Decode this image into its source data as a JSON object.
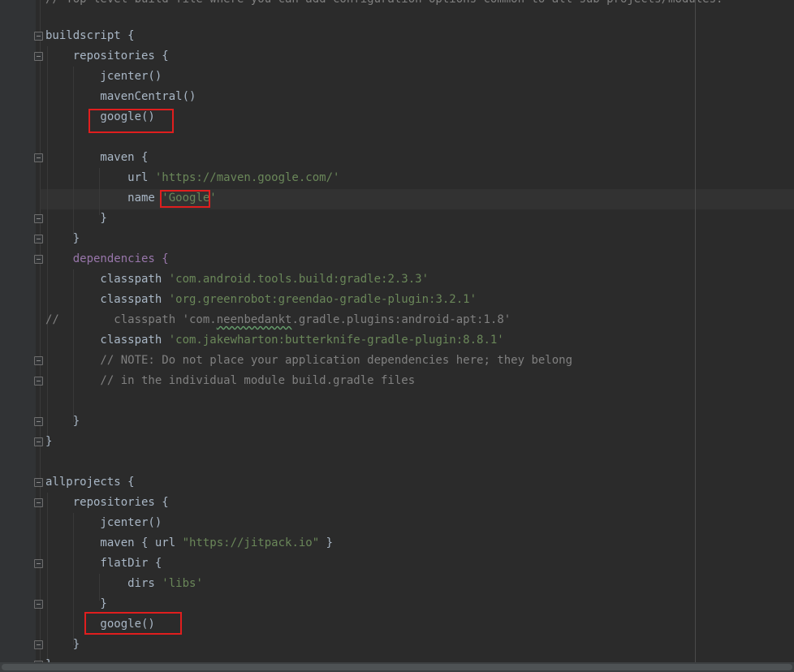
{
  "editor": {
    "top_fragment": "// Top-level build file where you can add configuration options common to all sub-projects/modules.",
    "lines": [
      {
        "parts": [
          {
            "t": "buildscript {",
            "c": "kw"
          }
        ]
      },
      {
        "parts": [
          {
            "t": "    repositories {",
            "c": "kw"
          }
        ]
      },
      {
        "parts": [
          {
            "t": "        jcenter()",
            "c": "fn"
          }
        ]
      },
      {
        "parts": [
          {
            "t": "        mavenCentral()",
            "c": "fn"
          }
        ]
      },
      {
        "parts": [
          {
            "t": "        google()",
            "c": "fn"
          }
        ]
      },
      {
        "parts": [
          {
            "t": "",
            "c": "kw"
          }
        ]
      },
      {
        "parts": [
          {
            "t": "        maven {",
            "c": "kw"
          }
        ]
      },
      {
        "parts": [
          {
            "t": "            url ",
            "c": "kw"
          },
          {
            "t": "'https://maven.google.com/'",
            "c": "str"
          }
        ]
      },
      {
        "parts": [
          {
            "t": "            name ",
            "c": "kw"
          },
          {
            "t": "'Google'",
            "c": "str"
          }
        ]
      },
      {
        "parts": [
          {
            "t": "        }",
            "c": "kw"
          }
        ]
      },
      {
        "parts": [
          {
            "t": "    }",
            "c": "kw"
          }
        ]
      },
      {
        "parts": [
          {
            "t": "    dependencies {",
            "c": "kw2"
          }
        ]
      },
      {
        "parts": [
          {
            "t": "        classpath ",
            "c": "kw"
          },
          {
            "t": "'com.android.tools.build:gradle:2.3.3'",
            "c": "str"
          }
        ]
      },
      {
        "parts": [
          {
            "t": "        classpath ",
            "c": "kw"
          },
          {
            "t": "'org.greenrobot:greendao-gradle-plugin:3.2.1'",
            "c": "str"
          }
        ]
      },
      {
        "parts": [
          {
            "t": "//        classpath ",
            "c": "cm"
          },
          {
            "t": "'com.neenbedankt.gradle.plugins:android-apt:1.8'",
            "c": "cm"
          }
        ]
      },
      {
        "parts": [
          {
            "t": "        classpath ",
            "c": "kw"
          },
          {
            "t": "'com.jakewharton:butterknife-gradle-plugin:8.8.1'",
            "c": "str"
          }
        ]
      },
      {
        "parts": [
          {
            "t": "        // NOTE: Do not place your application dependencies here; they belong",
            "c": "cm"
          }
        ]
      },
      {
        "parts": [
          {
            "t": "        // in the individual module build.gradle files",
            "c": "cm"
          }
        ]
      },
      {
        "parts": [
          {
            "t": "",
            "c": "kw"
          }
        ]
      },
      {
        "parts": [
          {
            "t": "    }",
            "c": "kw"
          }
        ]
      },
      {
        "parts": [
          {
            "t": "}",
            "c": "kw"
          }
        ]
      },
      {
        "parts": [
          {
            "t": "",
            "c": "kw"
          }
        ]
      },
      {
        "parts": [
          {
            "t": "allprojects {",
            "c": "kw"
          }
        ]
      },
      {
        "parts": [
          {
            "t": "    repositories {",
            "c": "kw"
          }
        ]
      },
      {
        "parts": [
          {
            "t": "        jcenter()",
            "c": "fn"
          }
        ]
      },
      {
        "parts": [
          {
            "t": "        maven { url ",
            "c": "kw"
          },
          {
            "t": "\"https://jitpack.io\"",
            "c": "str"
          },
          {
            "t": " }",
            "c": "kw"
          }
        ]
      },
      {
        "parts": [
          {
            "t": "        flatDir {",
            "c": "kw"
          }
        ]
      },
      {
        "parts": [
          {
            "t": "            dirs ",
            "c": "kw"
          },
          {
            "t": "'libs'",
            "c": "str"
          }
        ]
      },
      {
        "parts": [
          {
            "t": "        }",
            "c": "kw"
          }
        ]
      },
      {
        "parts": [
          {
            "t": "        google()",
            "c": "fn"
          }
        ]
      },
      {
        "parts": [
          {
            "t": "    }",
            "c": "kw"
          }
        ]
      },
      {
        "parts": [
          {
            "t": "}",
            "c": "kw"
          }
        ]
      }
    ]
  },
  "colors": {
    "background": "#2b2b2b",
    "highlight_box": "#e01e1e",
    "string": "#6a8759",
    "comment": "#808080"
  }
}
